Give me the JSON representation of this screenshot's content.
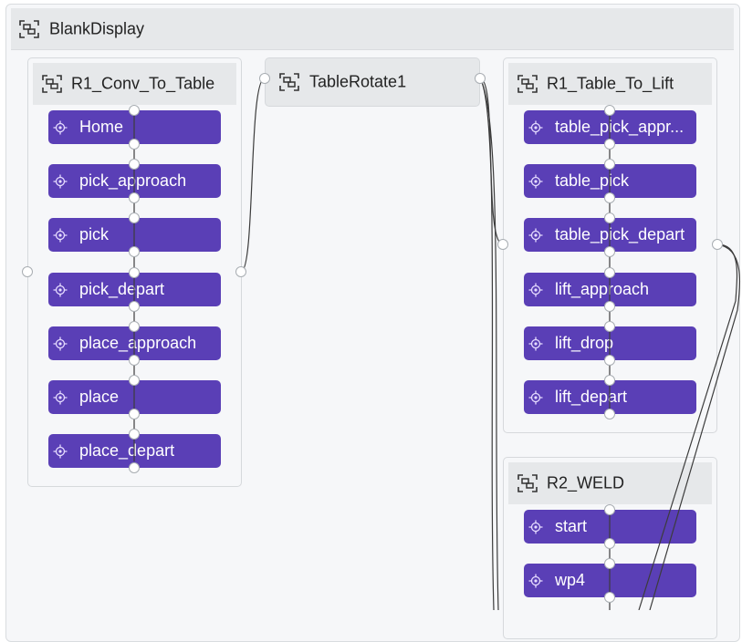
{
  "root": {
    "title": "BlankDisplay"
  },
  "groups": {
    "conv": {
      "title": "R1_Conv_To_Table",
      "items": [
        "Home",
        "pick_approach",
        "pick",
        "pick_depart",
        "place_approach",
        "place",
        "place_depart"
      ]
    },
    "rotate": {
      "title": "TableRotate1"
    },
    "lift": {
      "title": "R1_Table_To_Lift",
      "items": [
        "table_pick_appr...",
        "table_pick",
        "table_pick_depart",
        "lift_approach",
        "lift_drop",
        "lift_depart"
      ]
    },
    "weld": {
      "title": "R2_WELD",
      "items": [
        "start",
        "wp4"
      ]
    }
  },
  "icons": {
    "group": "group-frame-icon",
    "waypoint": "target-icon"
  },
  "colors": {
    "waypoint_bg": "#5a3fb6",
    "panel_bg": "#f6f7f9",
    "header_bg": "#e6e8ea"
  }
}
